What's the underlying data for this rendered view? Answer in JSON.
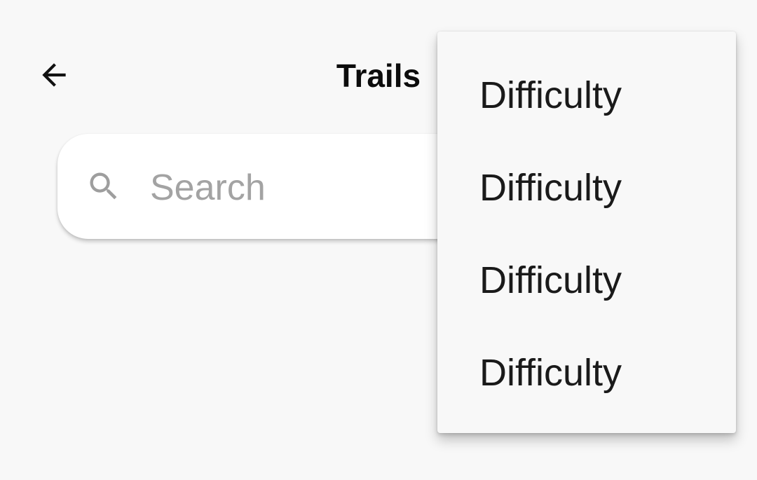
{
  "app_bar": {
    "back_icon": "arrow-back-icon",
    "title": "Trails"
  },
  "search": {
    "icon": "search-icon",
    "placeholder": "Search",
    "value": ""
  },
  "menu": {
    "items": [
      {
        "label": "Difficulty"
      },
      {
        "label": "Difficulty"
      },
      {
        "label": "Difficulty"
      },
      {
        "label": "Difficulty"
      }
    ]
  },
  "colors": {
    "background": "#f8f8f8",
    "search_background": "#ffffff",
    "placeholder": "#a3a3a3",
    "icon": "#9e9e9e",
    "text": "#1a1a1a"
  }
}
